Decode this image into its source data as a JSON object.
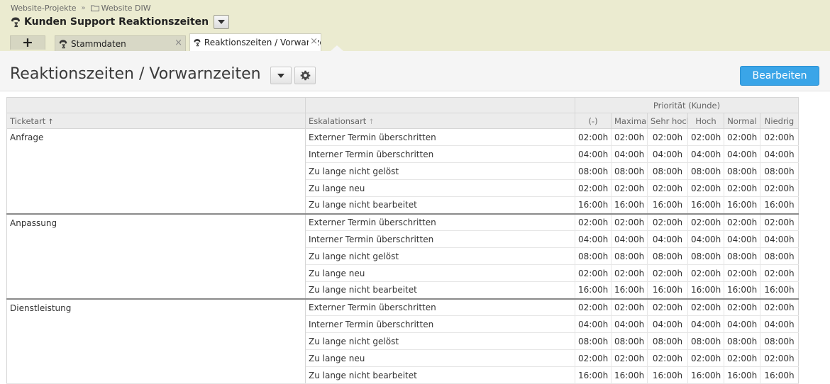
{
  "breadcrumb": {
    "items": [
      "Website-Projekte",
      "Website DIW"
    ],
    "separator": "»"
  },
  "context": {
    "title": "Kunden Support Reaktionszeiten"
  },
  "tabs": {
    "add_label": "+",
    "items": [
      {
        "label": "Stammdaten",
        "active": false,
        "close": "×"
      },
      {
        "label": "Reaktionszeiten / Vorwarnzeiten",
        "active": true,
        "close": "×"
      }
    ]
  },
  "page": {
    "title": "Reaktionszeiten / Vorwarnzeiten",
    "edit_button": "Bearbeiten"
  },
  "colors": {
    "accent": "#3aa5e8",
    "header_bg": "#ebebd0"
  },
  "table": {
    "group_header": "Priorität (Kunde)",
    "columns": [
      "Ticketart",
      "Eskalationsart",
      "(-)",
      "Maximal",
      "Sehr hoch",
      "Hoch",
      "Normal",
      "Niedrig"
    ],
    "sort_icon": "↑",
    "groups": [
      {
        "ticketart": "Anfrage",
        "rows": [
          {
            "eskalationsart": "Externer Termin überschritten",
            "values": [
              "02:00h",
              "02:00h",
              "02:00h",
              "02:00h",
              "02:00h",
              "02:00h"
            ]
          },
          {
            "eskalationsart": "Interner Termin überschritten",
            "values": [
              "04:00h",
              "04:00h",
              "04:00h",
              "04:00h",
              "04:00h",
              "04:00h"
            ]
          },
          {
            "eskalationsart": "Zu lange nicht gelöst",
            "values": [
              "08:00h",
              "08:00h",
              "08:00h",
              "08:00h",
              "08:00h",
              "08:00h"
            ]
          },
          {
            "eskalationsart": "Zu lange neu",
            "values": [
              "02:00h",
              "02:00h",
              "02:00h",
              "02:00h",
              "02:00h",
              "02:00h"
            ]
          },
          {
            "eskalationsart": "Zu lange nicht bearbeitet",
            "values": [
              "16:00h",
              "16:00h",
              "16:00h",
              "16:00h",
              "16:00h",
              "16:00h"
            ]
          }
        ]
      },
      {
        "ticketart": "Anpassung",
        "rows": [
          {
            "eskalationsart": "Externer Termin überschritten",
            "values": [
              "02:00h",
              "02:00h",
              "02:00h",
              "02:00h",
              "02:00h",
              "02:00h"
            ]
          },
          {
            "eskalationsart": "Interner Termin überschritten",
            "values": [
              "04:00h",
              "04:00h",
              "04:00h",
              "04:00h",
              "04:00h",
              "04:00h"
            ]
          },
          {
            "eskalationsart": "Zu lange nicht gelöst",
            "values": [
              "08:00h",
              "08:00h",
              "08:00h",
              "08:00h",
              "08:00h",
              "08:00h"
            ]
          },
          {
            "eskalationsart": "Zu lange neu",
            "values": [
              "02:00h",
              "02:00h",
              "02:00h",
              "02:00h",
              "02:00h",
              "02:00h"
            ]
          },
          {
            "eskalationsart": "Zu lange nicht bearbeitet",
            "values": [
              "16:00h",
              "16:00h",
              "16:00h",
              "16:00h",
              "16:00h",
              "16:00h"
            ]
          }
        ]
      },
      {
        "ticketart": "Dienstleistung",
        "rows": [
          {
            "eskalationsart": "Externer Termin überschritten",
            "values": [
              "02:00h",
              "02:00h",
              "02:00h",
              "02:00h",
              "02:00h",
              "02:00h"
            ]
          },
          {
            "eskalationsart": "Interner Termin überschritten",
            "values": [
              "04:00h",
              "04:00h",
              "04:00h",
              "04:00h",
              "04:00h",
              "04:00h"
            ]
          },
          {
            "eskalationsart": "Zu lange nicht gelöst",
            "values": [
              "08:00h",
              "08:00h",
              "08:00h",
              "08:00h",
              "08:00h",
              "08:00h"
            ]
          },
          {
            "eskalationsart": "Zu lange neu",
            "values": [
              "02:00h",
              "02:00h",
              "02:00h",
              "02:00h",
              "02:00h",
              "02:00h"
            ]
          },
          {
            "eskalationsart": "Zu lange nicht bearbeitet",
            "values": [
              "16:00h",
              "16:00h",
              "16:00h",
              "16:00h",
              "16:00h",
              "16:00h"
            ]
          }
        ]
      }
    ]
  }
}
